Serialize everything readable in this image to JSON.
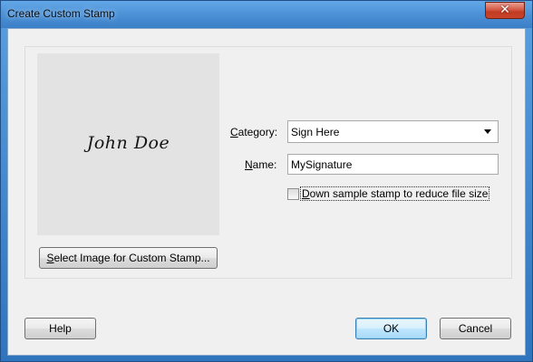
{
  "window": {
    "title": "Create Custom Stamp",
    "close_glyph": "✕"
  },
  "preview": {
    "signature_text": "John Doe"
  },
  "buttons": {
    "select_image": {
      "mnemonic": "S",
      "rest": "elect Image for Custom Stamp..."
    },
    "help": "Help",
    "ok": "OK",
    "cancel": "Cancel"
  },
  "form": {
    "category_label": {
      "mnemonic": "C",
      "rest": "ategory:"
    },
    "category_value": "Sign Here",
    "name_label": {
      "mnemonic": "N",
      "rest": "ame:"
    },
    "name_value": "MySignature",
    "downsample_label": {
      "mnemonic": "D",
      "rest": "own sample stamp to reduce file size"
    },
    "downsample_checked": false
  },
  "colors": {
    "titlebar": "#4a8fd4",
    "close_button": "#c7452b",
    "dialog_background": "#f0f0f0",
    "preview_background": "#e3e3e3",
    "default_button_border": "#3c7fb1"
  },
  "icons": {
    "close": "close-icon",
    "dropdown": "chevron-down-icon"
  }
}
